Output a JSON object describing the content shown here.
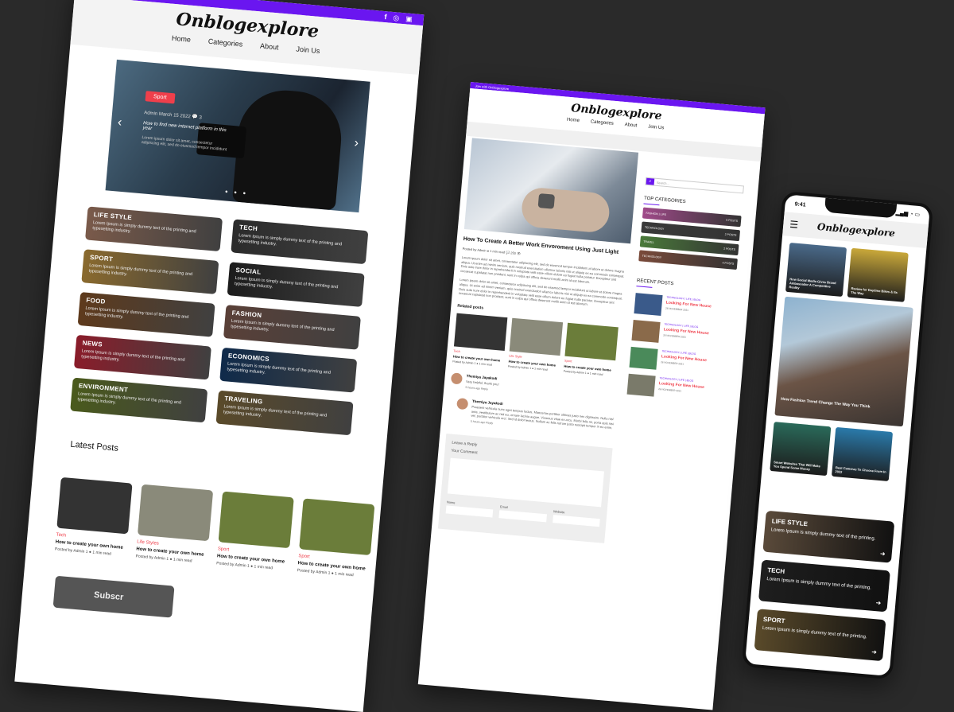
{
  "desktop": {
    "social_icons": [
      "f",
      "◎",
      "▣"
    ],
    "logo": "Onblogexplore",
    "nav": [
      "Home",
      "Categories",
      "About",
      "Join Us"
    ],
    "hero": {
      "tag": "Sport",
      "meta": "Admin  March 15  2022  💬 3",
      "title": "How to find new internet platform in this year",
      "desc": "Lorem ipsum dolor sit amet, consectetur adipiscing elit, sed do eiusmod tempor incididunt"
    },
    "categories": [
      {
        "name": "LIFE STYLE",
        "desc": "Lorem Ipsum is simply dummy text of the printing and typesetting industry.",
        "color": "#7a5a4a"
      },
      {
        "name": "TECH",
        "desc": "Lorem Ipsum is simply dummy text of the printing and typesetting industry.",
        "color": "#2b2b2b"
      },
      {
        "name": "SPORT",
        "desc": "Lorem Ipsum is simply dummy text of the printing and typesetting industry.",
        "color": "#8a6a2e"
      },
      {
        "name": "SOCIAL",
        "desc": "Lorem Ipsum is simply dummy text of the printing and typesetting industry.",
        "color": "#1c1c1c"
      },
      {
        "name": "FOOD",
        "desc": "Lorem Ipsum is simply dummy text of the printing and typesetting industry.",
        "color": "#5e3a1c"
      },
      {
        "name": "FASHION",
        "desc": "Lorem Ipsum is simply dummy text of the printing and typesetting industry.",
        "color": "#5a4038"
      },
      {
        "name": "NEWS",
        "desc": "Lorem Ipsum is simply dummy text of the printing and typesetting industry.",
        "color": "#8a1c2a"
      },
      {
        "name": "ECONOMICS",
        "desc": "Lorem Ipsum is simply dummy text of the printing and typesetting industry.",
        "color": "#0f2a4a"
      },
      {
        "name": "ENVIRONMENT",
        "desc": "Lorem Ipsum is simply dummy text of the printing and typesetting industry.",
        "color": "#4a5a1c"
      },
      {
        "name": "TRAVELING",
        "desc": "Lorem Ipsum is simply dummy text of the printing and typesetting industry.",
        "color": "#5a4a2a"
      }
    ],
    "latest_title": "Latest Posts",
    "posts": [
      {
        "cat": "Tech",
        "title": "How to create your own home",
        "meta": "Posted by Admin 1  ● 1 min read",
        "color": "#333"
      },
      {
        "cat": "Life Styles",
        "title": "How to create your own home",
        "meta": "Posted by Admin 1  ● 1 min read",
        "color": "#8a8a7a"
      },
      {
        "cat": "Sport",
        "title": "How to create your own home",
        "meta": "Posted by Admin 1  ● 1 min read",
        "color": "#6b7d3a"
      },
      {
        "cat": "Sport",
        "title": "How to create your own home",
        "meta": "Posted by Admin 1  ● 1 min read",
        "color": "#6b7d3a"
      }
    ],
    "subscribe": "Subscr"
  },
  "blog": {
    "topbar": "Join with Onblogexplore",
    "logo": "Onblogexplore",
    "nav": [
      "Home",
      "Categories",
      "About",
      "Join Us"
    ],
    "post_title": "How To Create A Better Work Envoroment Using Just Light",
    "post_meta": "Posted by Admin  ● 1 min read   💬 250   👁",
    "body1": "Lorem ipsum dolor sit amet, consectetur adipiscing elit, sed do eiusmod tempor incididunt ut labore et dolore magna aliqua. Ut enim ad minim veniam, quis nostrud exercitation ullamco laboris nisi ut aliquip ex ea commodo consequat. Duis aute irure dolor in reprehenderit in voluptate velit esse cillum dolore eu fugiat nulla pariatur. Excepteur sint occaecat cupidatat non proident, sunt in culpa qui officia deserunt mollit anim id est laborum.",
    "body2": "Lorem ipsum dolor sit amet, consectetur adipiscing elit, sed do eiusmod tempor incididunt ut labore et dolore magna aliqua. Ut enim ad minim veniam, quis nostrud exercitation ullamco laboris nisi ut aliquip ex ea commodo consequat. Duis aute irure dolor in reprehenderit in voluptate velit esse cillum dolore eu fugiat nulla pariatur. Excepteur sint occaecat cupidatat non proident, sunt in culpa qui officia deserunt mollit anim id est laborum.",
    "related_title": "Related posts",
    "related": [
      {
        "cat": "Tech",
        "title": "How to create your own home",
        "meta": "Posted by Admin 1 ● 1 min read",
        "color": "#333"
      },
      {
        "cat": "Life Style",
        "title": "How to create your own home",
        "meta": "Posted by Admin 1 ● 1 min read",
        "color": "#8a8a7a"
      },
      {
        "cat": "Sport",
        "title": "How to create your own home",
        "meta": "Posted by Admin 1 ● 1 min read",
        "color": "#6b7d3a"
      }
    ],
    "comments": [
      {
        "name": "Themiya Jayakodi",
        "text": "Very helpful, thank you!",
        "time": "5 hours ago",
        "reply": "Reply"
      },
      {
        "name": "Themiya Jayakodi",
        "text": "Praesent vehicula nunc eget tempus luctus. Maecenas porttitor ultrices justo nec dignissim. Nulla nisl ante, vestibulum ac nisl eu, ornare lacinia augue. Vivamus vitae ex arcu. Morbi felis mi, porta quis nisi vel, porttitor vehicula orci. Sed id dolor lectus. Nullam ac felis rutrum justo suscipit tempor in eu enim.",
        "time": "5 hours ago",
        "reply": "Reply"
      }
    ],
    "reply": {
      "title": "Leave a Reply",
      "comment_label": "Your Comment",
      "name": "Name",
      "email": "Email",
      "website": "Website"
    },
    "search_placeholder": "Search...",
    "top_categories_title": "TOP CATEGORIES",
    "top_categories": [
      {
        "name": "FASHION | LIFE",
        "count": "5 POSTS",
        "color": "#a04a8a"
      },
      {
        "name": "TECHNOLOGY",
        "count": "2 POSTS",
        "color": "#3a3a3a"
      },
      {
        "name": "TRAVEL",
        "count": "2 POSTS",
        "color": "#4a7a3a"
      },
      {
        "name": "TECHNOLOGY",
        "count": "4 POSTS",
        "color": "#7a4a3a"
      }
    ],
    "recent_title": "RECENT POSTS",
    "recent": [
      {
        "cat": "TECHNOLOGY | LIFE | BLOG",
        "title": "Looking For New House",
        "date": "26 NOVEMBER 2021",
        "color": "#3a5a8a"
      },
      {
        "cat": "TECHNOLOGY | LIFE | BLOG",
        "title": "Looking For New House",
        "date": "26 NOVEMBER 2021",
        "color": "#8a6a4a"
      },
      {
        "cat": "TECHNOLOGY | LIFE | BLOG",
        "title": "Looking For New House",
        "date": "26 NOVEMBER 2021",
        "color": "#4a8a5a"
      },
      {
        "cat": "TECHNOLOGY | LIFE | BLOG",
        "title": "Looking For New House",
        "date": "26 NOVEMBER 2021",
        "color": "#7a7a6a"
      }
    ]
  },
  "mobile": {
    "time": "9:41",
    "status_icons": "▂▄▆ ◔ ▭",
    "logo": "Onblogexplore",
    "menu_icon": "☰",
    "tiles": [
      {
        "text": "How Social Media Gives Brand Ambassador A Competitive Reality",
        "color": "#4a6a8a"
      },
      {
        "text": "Review for Daytime Bikes & Its The Way",
        "color": "#c9a83a"
      }
    ],
    "feature": "How Fashion Trend Change The Way You Think",
    "tiles2": [
      {
        "text": "Smart Websites That Will Make You Spend Some Money",
        "color": "#2a6a5a"
      },
      {
        "text": "Best Cameras To Choose From In 2022",
        "color": "#2a7aaa"
      }
    ],
    "cats": [
      {
        "name": "LIFE STYLE",
        "desc": "Lorem Ipsum is simply dummy text of the printing.",
        "color": "#5a4a3a",
        "arrow": "➜"
      },
      {
        "name": "TECH",
        "desc": "Lorem Ipsum is simply dummy text of the printing.",
        "color": "#1e1e1e",
        "arrow": "➜"
      },
      {
        "name": "SPORT",
        "desc": "Lorem Ipsum is simply dummy text of the printing.",
        "color": "#5a4a2a",
        "arrow": "➜"
      }
    ]
  }
}
